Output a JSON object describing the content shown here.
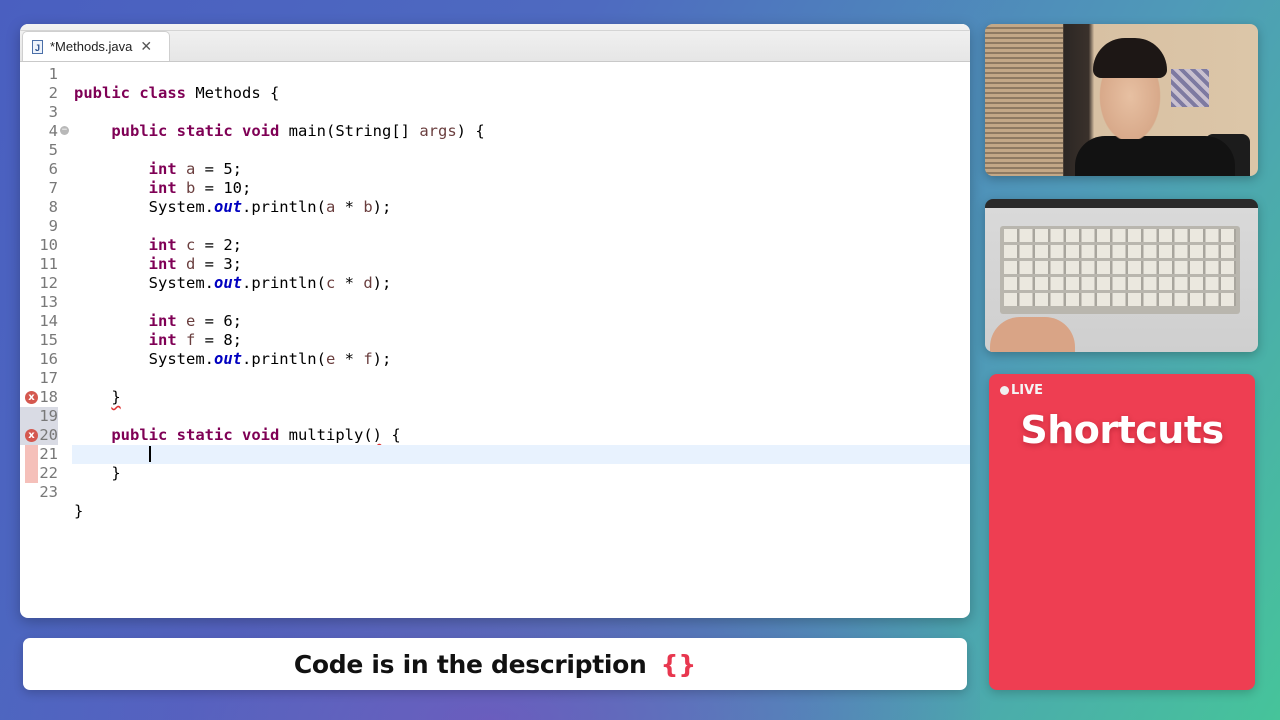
{
  "editor": {
    "tab": {
      "icon": "java-file-icon",
      "label": "*Methods.java",
      "close_glyph": "✕"
    },
    "error_glyph": "x",
    "fold_glyph": "−",
    "lines": [
      {
        "n": "1",
        "tokens": []
      },
      {
        "n": "2",
        "tokens": [
          {
            "t": "public",
            "c": "kw"
          },
          {
            "t": " "
          },
          {
            "t": "class",
            "c": "kw"
          },
          {
            "t": " Methods {"
          }
        ]
      },
      {
        "n": "3",
        "tokens": []
      },
      {
        "n": "4",
        "fold": true,
        "tokens": [
          {
            "t": "    "
          },
          {
            "t": "public",
            "c": "kw"
          },
          {
            "t": " "
          },
          {
            "t": "static",
            "c": "kw"
          },
          {
            "t": " "
          },
          {
            "t": "void",
            "c": "kw"
          },
          {
            "t": " main(String[] "
          },
          {
            "t": "args",
            "c": "var"
          },
          {
            "t": ") {"
          }
        ]
      },
      {
        "n": "5",
        "tokens": []
      },
      {
        "n": "6",
        "tokens": [
          {
            "t": "        "
          },
          {
            "t": "int",
            "c": "kw"
          },
          {
            "t": " "
          },
          {
            "t": "a",
            "c": "var"
          },
          {
            "t": " = 5;"
          }
        ]
      },
      {
        "n": "7",
        "tokens": [
          {
            "t": "        "
          },
          {
            "t": "int",
            "c": "kw"
          },
          {
            "t": " "
          },
          {
            "t": "b",
            "c": "var"
          },
          {
            "t": " = 10;"
          }
        ]
      },
      {
        "n": "8",
        "tokens": [
          {
            "t": "        System."
          },
          {
            "t": "out",
            "c": "fld"
          },
          {
            "t": ".println("
          },
          {
            "t": "a",
            "c": "var"
          },
          {
            "t": " * "
          },
          {
            "t": "b",
            "c": "var"
          },
          {
            "t": ");"
          }
        ]
      },
      {
        "n": "9",
        "tokens": []
      },
      {
        "n": "10",
        "tokens": [
          {
            "t": "        "
          },
          {
            "t": "int",
            "c": "kw"
          },
          {
            "t": " "
          },
          {
            "t": "c",
            "c": "var"
          },
          {
            "t": " = 2;"
          }
        ]
      },
      {
        "n": "11",
        "tokens": [
          {
            "t": "        "
          },
          {
            "t": "int",
            "c": "kw"
          },
          {
            "t": " "
          },
          {
            "t": "d",
            "c": "var"
          },
          {
            "t": " = 3;"
          }
        ]
      },
      {
        "n": "12",
        "tokens": [
          {
            "t": "        System."
          },
          {
            "t": "out",
            "c": "fld"
          },
          {
            "t": ".println("
          },
          {
            "t": "c",
            "c": "var"
          },
          {
            "t": " * "
          },
          {
            "t": "d",
            "c": "var"
          },
          {
            "t": ");"
          }
        ]
      },
      {
        "n": "13",
        "tokens": []
      },
      {
        "n": "14",
        "tokens": [
          {
            "t": "        "
          },
          {
            "t": "int",
            "c": "kw"
          },
          {
            "t": " "
          },
          {
            "t": "e",
            "c": "var"
          },
          {
            "t": " = 6;"
          }
        ]
      },
      {
        "n": "15",
        "tokens": [
          {
            "t": "        "
          },
          {
            "t": "int",
            "c": "kw"
          },
          {
            "t": " "
          },
          {
            "t": "f",
            "c": "var"
          },
          {
            "t": " = 8;"
          }
        ]
      },
      {
        "n": "16",
        "tokens": [
          {
            "t": "        System."
          },
          {
            "t": "out",
            "c": "fld"
          },
          {
            "t": ".println("
          },
          {
            "t": "e",
            "c": "var"
          },
          {
            "t": " * "
          },
          {
            "t": "f",
            "c": "var"
          },
          {
            "t": ");"
          }
        ]
      },
      {
        "n": "17",
        "tokens": []
      },
      {
        "n": "18",
        "error": true,
        "tokens": [
          {
            "t": "    "
          },
          {
            "t": "}",
            "c": "err"
          }
        ]
      },
      {
        "n": "19",
        "hl": true,
        "tokens": []
      },
      {
        "n": "20",
        "error": true,
        "hl": true,
        "tokens": [
          {
            "t": "    "
          },
          {
            "t": "public",
            "c": "kw"
          },
          {
            "t": " "
          },
          {
            "t": "static",
            "c": "kw"
          },
          {
            "t": " "
          },
          {
            "t": "void",
            "c": "kw"
          },
          {
            "t": " multiply("
          },
          {
            "t": ")",
            "c": "err"
          },
          {
            "t": " {"
          }
        ]
      },
      {
        "n": "21",
        "current": true,
        "caret": true,
        "tokens": [
          {
            "t": "        "
          }
        ]
      },
      {
        "n": "22",
        "tokens": [
          {
            "t": "    }"
          }
        ]
      },
      {
        "n": "23",
        "tokens": []
      },
      {
        "n": "",
        "tokens": [
          {
            "t": "}"
          }
        ]
      }
    ]
  },
  "caption": {
    "text": "Code is in the description",
    "braces": "{}"
  },
  "webcams": [
    {
      "name": "face-camera"
    },
    {
      "name": "keyboard-camera"
    }
  ],
  "live_card": {
    "badge": "LIVE",
    "title": "Shortcuts",
    "color": "#ee3e52"
  }
}
